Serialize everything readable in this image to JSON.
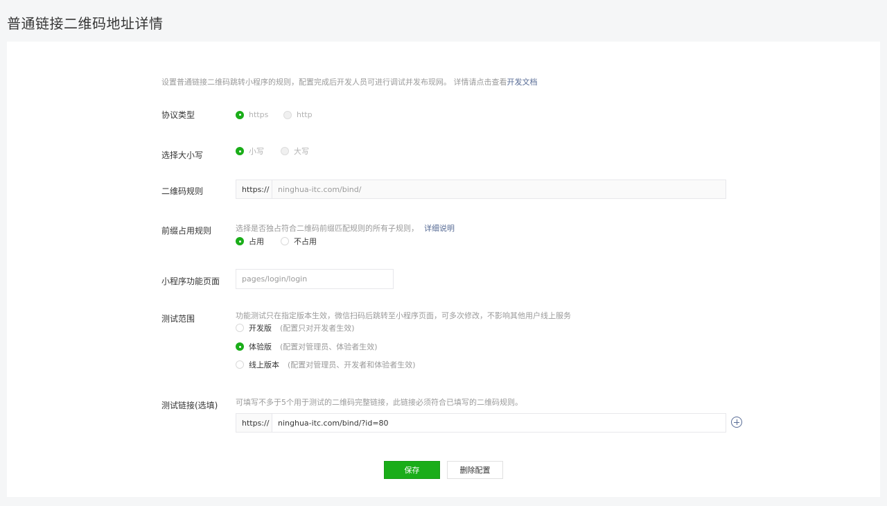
{
  "page_title": "普通链接二维码地址详情",
  "intro": {
    "text": "设置普通链接二维码跳转小程序的规则，配置完成后开发人员可进行调试并发布现网。 详情请点击查看",
    "link": "开发文档"
  },
  "protocol": {
    "label": "协议类型",
    "options": [
      "https",
      "http"
    ],
    "selected": "https"
  },
  "case": {
    "label": "选择大小写",
    "options": [
      "小写",
      "大写"
    ],
    "selected": "小写"
  },
  "qr_rule": {
    "label": "二维码规则",
    "prefix": "https://",
    "value": "ninghua-itc.com/bind/"
  },
  "prefix_rule": {
    "label": "前缀占用规则",
    "hint": "选择是否独占符合二维码前缀匹配规则的所有子规则，",
    "hint_link": "详细说明",
    "options": [
      "占用",
      "不占用"
    ],
    "selected": "占用"
  },
  "page_path": {
    "label": "小程序功能页面",
    "value": "pages/login/login"
  },
  "test_scope": {
    "label": "测试范围",
    "hint": "功能测试只在指定版本生效，微信扫码后跳转至小程序页面，可多次修改，不影响其他用户线上服务",
    "options": [
      {
        "label": "开发版",
        "note": "(配置只对开发者生效)"
      },
      {
        "label": "体验版",
        "note": "(配置对管理员、体验者生效)"
      },
      {
        "label": "线上版本",
        "note": "(配置对管理员、开发者和体验者生效)"
      }
    ],
    "selected": "体验版"
  },
  "test_link": {
    "label": "测试链接(选填)",
    "hint": "可填写不多于5个用于测试的二维码完整链接，此链接必须符合已填写的二维码规则。",
    "prefix": "https://",
    "value": "ninghua-itc.com/bind/?id=80",
    "add_icon": "plus-circle-icon"
  },
  "buttons": {
    "save": "保存",
    "delete": "删除配置"
  },
  "colors": {
    "accent": "#1aad19",
    "link": "#576b95"
  }
}
